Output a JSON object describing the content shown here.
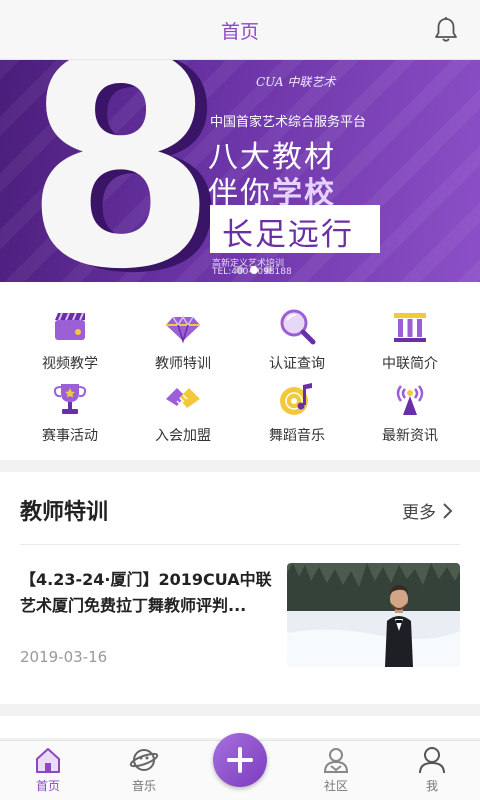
{
  "header": {
    "title": "首页",
    "bell_icon": "bell-icon"
  },
  "banner": {
    "big_number": "8",
    "logo_text": "CUA 中联艺术",
    "subtitle": "中国首家艺术综合服务平台",
    "line1_prefix": "八大",
    "line1_suffix": "教材",
    "line2_prefix": "伴你",
    "line2_suffix": "学校",
    "box_text": "长足远行",
    "fine_print_1": "高新定义艺术培训",
    "fine_print_2": "TEL:400-0098188",
    "slides": 3,
    "active_slide": 2
  },
  "grid": [
    {
      "label": "视频教学",
      "icon": "video-icon"
    },
    {
      "label": "教师特训",
      "icon": "diamond-icon"
    },
    {
      "label": "认证查询",
      "icon": "magnifier-icon"
    },
    {
      "label": "中联简介",
      "icon": "pillars-icon"
    },
    {
      "label": "赛事活动",
      "icon": "trophy-icon"
    },
    {
      "label": "入会加盟",
      "icon": "handshake-icon"
    },
    {
      "label": "舞蹈音乐",
      "icon": "music-icon"
    },
    {
      "label": "最新资讯",
      "icon": "broadcast-icon"
    }
  ],
  "section": {
    "title": "教师特训",
    "more_label": "更多",
    "article": {
      "title": "【4.23-24·厦门】2019CUA中联艺术厦门免费拉丁舞教师评判...",
      "date": "2019-03-16",
      "thumb_icon": "man-in-suit-photo"
    }
  },
  "tabs": [
    {
      "label": "首页",
      "icon": "home-icon",
      "active": true
    },
    {
      "label": "音乐",
      "icon": "planet-icon",
      "active": false
    },
    {
      "label": "",
      "icon": "plus-icon",
      "active": false
    },
    {
      "label": "社区",
      "icon": "community-icon",
      "active": false
    },
    {
      "label": "我",
      "icon": "person-icon",
      "active": false
    }
  ],
  "colors": {
    "accent": "#8e47c4",
    "banner_dark": "#4a1d7a",
    "banner_light": "#8c4fc7"
  }
}
